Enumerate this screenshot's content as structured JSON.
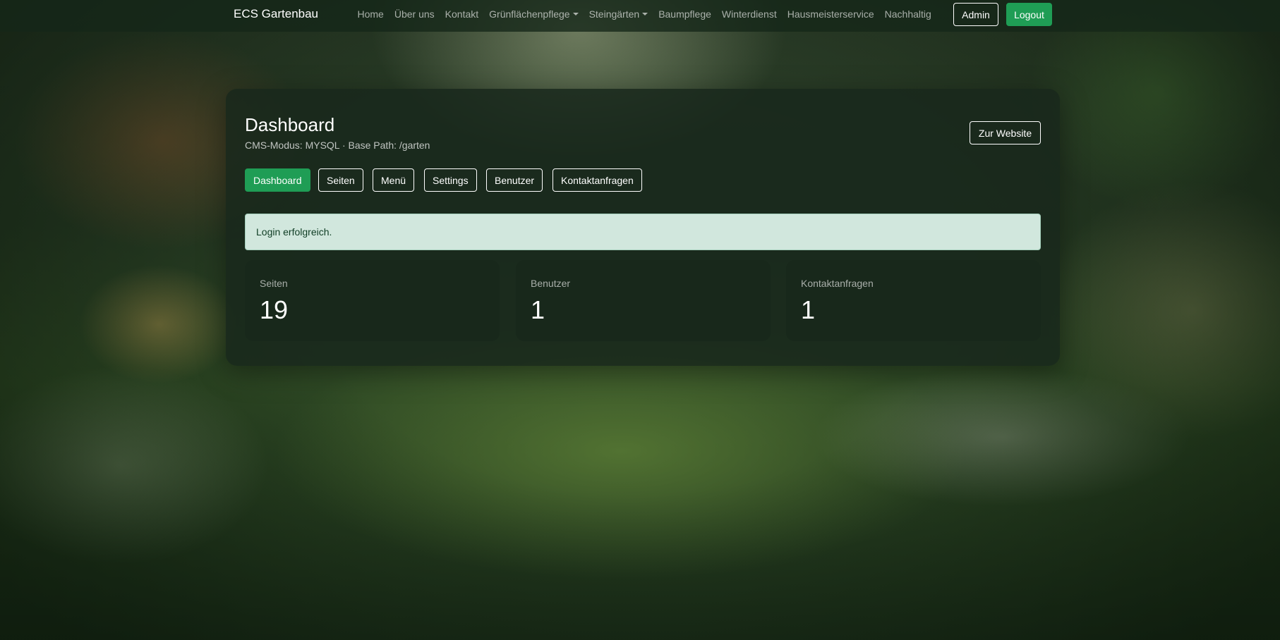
{
  "navbar": {
    "brand": "ECS Gartenbau",
    "links": [
      {
        "label": "Home"
      },
      {
        "label": "Über uns"
      },
      {
        "label": "Kontakt"
      },
      {
        "label": "Grünflächenpflege",
        "dropdown": true
      },
      {
        "label": "Steingärten",
        "dropdown": true
      },
      {
        "label": "Baumpflege"
      },
      {
        "label": "Winterdienst"
      },
      {
        "label": "Hausmeisterservice"
      },
      {
        "label": "Nachhaltig"
      }
    ],
    "admin_label": "Admin",
    "logout_label": "Logout"
  },
  "header": {
    "title": "Dashboard",
    "subtitle": "CMS-Modus: MYSQL · Base Path: /garten",
    "website_button": "Zur Website"
  },
  "tabs": [
    {
      "label": "Dashboard",
      "active": true
    },
    {
      "label": "Seiten"
    },
    {
      "label": "Menü"
    },
    {
      "label": "Settings"
    },
    {
      "label": "Benutzer"
    },
    {
      "label": "Kontaktanfragen"
    }
  ],
  "alert": {
    "message": "Login erfolgreich."
  },
  "stats": [
    {
      "label": "Seiten",
      "value": "19"
    },
    {
      "label": "Benutzer",
      "value": "1"
    },
    {
      "label": "Kontaktanfragen",
      "value": "1"
    }
  ],
  "colors": {
    "accent": "#1f9d55",
    "alert_bg": "#d1e7dd",
    "panel_bg": "#18281c"
  },
  "icons": {
    "dropdown": "chevron-down-icon"
  }
}
